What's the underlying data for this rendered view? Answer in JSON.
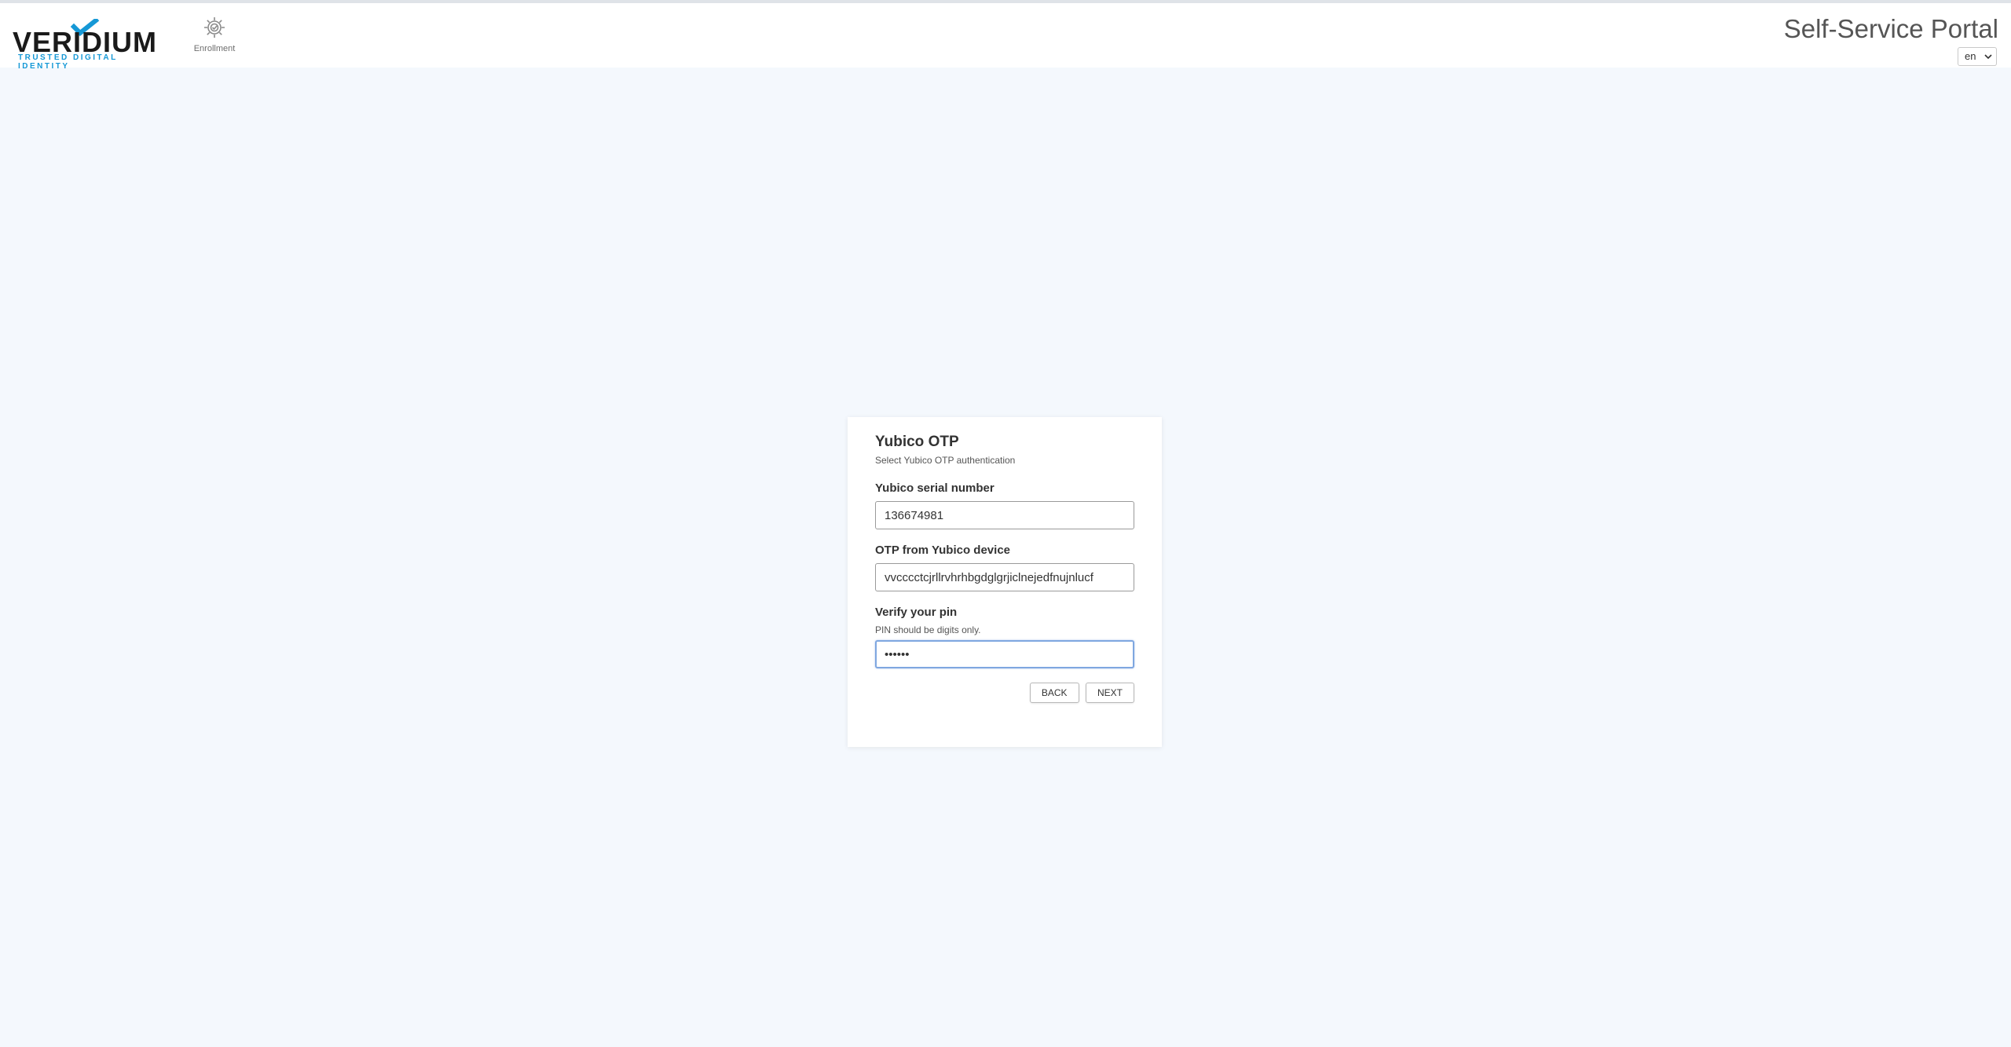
{
  "brand": {
    "name": "VERIDIUM",
    "tagline": "TRUSTED DIGITAL IDENTITY",
    "check_color": "#1598d6"
  },
  "nav": {
    "items": [
      {
        "label": "Enrollment",
        "icon": "enrollment-gear-icon"
      }
    ]
  },
  "header": {
    "title": "Self-Service Portal",
    "language": "en"
  },
  "form": {
    "title": "Yubico OTP",
    "subtitle": "Select Yubico OTP authentication",
    "serial": {
      "label": "Yubico serial number",
      "value": "136674981"
    },
    "otp": {
      "label": "OTP from Yubico device",
      "value": "vvcccctcjrllrvhrhbgdglgrjiclnejedfnujnlucf"
    },
    "pin": {
      "label": "Verify your pin",
      "hint": "PIN should be digits only.",
      "value": "123456"
    },
    "back_label": "BACK",
    "next_label": "NEXT"
  }
}
